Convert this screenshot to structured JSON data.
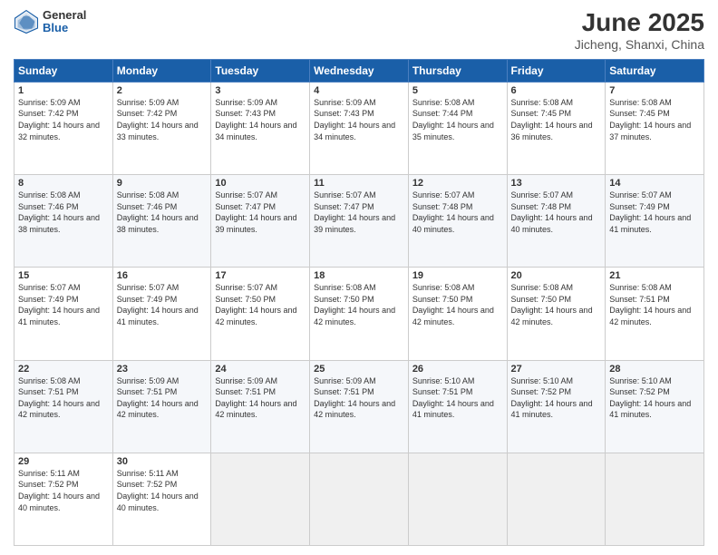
{
  "header": {
    "logo_general": "General",
    "logo_blue": "Blue",
    "title": "June 2025",
    "subtitle": "Jicheng, Shanxi, China"
  },
  "weekdays": [
    "Sunday",
    "Monday",
    "Tuesday",
    "Wednesday",
    "Thursday",
    "Friday",
    "Saturday"
  ],
  "weeks": [
    [
      {
        "day": "1",
        "sunrise": "5:09 AM",
        "sunset": "7:42 PM",
        "daylight": "14 hours and 32 minutes."
      },
      {
        "day": "2",
        "sunrise": "5:09 AM",
        "sunset": "7:42 PM",
        "daylight": "14 hours and 33 minutes."
      },
      {
        "day": "3",
        "sunrise": "5:09 AM",
        "sunset": "7:43 PM",
        "daylight": "14 hours and 34 minutes."
      },
      {
        "day": "4",
        "sunrise": "5:09 AM",
        "sunset": "7:43 PM",
        "daylight": "14 hours and 34 minutes."
      },
      {
        "day": "5",
        "sunrise": "5:08 AM",
        "sunset": "7:44 PM",
        "daylight": "14 hours and 35 minutes."
      },
      {
        "day": "6",
        "sunrise": "5:08 AM",
        "sunset": "7:45 PM",
        "daylight": "14 hours and 36 minutes."
      },
      {
        "day": "7",
        "sunrise": "5:08 AM",
        "sunset": "7:45 PM",
        "daylight": "14 hours and 37 minutes."
      }
    ],
    [
      {
        "day": "8",
        "sunrise": "5:08 AM",
        "sunset": "7:46 PM",
        "daylight": "14 hours and 38 minutes."
      },
      {
        "day": "9",
        "sunrise": "5:08 AM",
        "sunset": "7:46 PM",
        "daylight": "14 hours and 38 minutes."
      },
      {
        "day": "10",
        "sunrise": "5:07 AM",
        "sunset": "7:47 PM",
        "daylight": "14 hours and 39 minutes."
      },
      {
        "day": "11",
        "sunrise": "5:07 AM",
        "sunset": "7:47 PM",
        "daylight": "14 hours and 39 minutes."
      },
      {
        "day": "12",
        "sunrise": "5:07 AM",
        "sunset": "7:48 PM",
        "daylight": "14 hours and 40 minutes."
      },
      {
        "day": "13",
        "sunrise": "5:07 AM",
        "sunset": "7:48 PM",
        "daylight": "14 hours and 40 minutes."
      },
      {
        "day": "14",
        "sunrise": "5:07 AM",
        "sunset": "7:49 PM",
        "daylight": "14 hours and 41 minutes."
      }
    ],
    [
      {
        "day": "15",
        "sunrise": "5:07 AM",
        "sunset": "7:49 PM",
        "daylight": "14 hours and 41 minutes."
      },
      {
        "day": "16",
        "sunrise": "5:07 AM",
        "sunset": "7:49 PM",
        "daylight": "14 hours and 41 minutes."
      },
      {
        "day": "17",
        "sunrise": "5:07 AM",
        "sunset": "7:50 PM",
        "daylight": "14 hours and 42 minutes."
      },
      {
        "day": "18",
        "sunrise": "5:08 AM",
        "sunset": "7:50 PM",
        "daylight": "14 hours and 42 minutes."
      },
      {
        "day": "19",
        "sunrise": "5:08 AM",
        "sunset": "7:50 PM",
        "daylight": "14 hours and 42 minutes."
      },
      {
        "day": "20",
        "sunrise": "5:08 AM",
        "sunset": "7:50 PM",
        "daylight": "14 hours and 42 minutes."
      },
      {
        "day": "21",
        "sunrise": "5:08 AM",
        "sunset": "7:51 PM",
        "daylight": "14 hours and 42 minutes."
      }
    ],
    [
      {
        "day": "22",
        "sunrise": "5:08 AM",
        "sunset": "7:51 PM",
        "daylight": "14 hours and 42 minutes."
      },
      {
        "day": "23",
        "sunrise": "5:09 AM",
        "sunset": "7:51 PM",
        "daylight": "14 hours and 42 minutes."
      },
      {
        "day": "24",
        "sunrise": "5:09 AM",
        "sunset": "7:51 PM",
        "daylight": "14 hours and 42 minutes."
      },
      {
        "day": "25",
        "sunrise": "5:09 AM",
        "sunset": "7:51 PM",
        "daylight": "14 hours and 42 minutes."
      },
      {
        "day": "26",
        "sunrise": "5:10 AM",
        "sunset": "7:51 PM",
        "daylight": "14 hours and 41 minutes."
      },
      {
        "day": "27",
        "sunrise": "5:10 AM",
        "sunset": "7:52 PM",
        "daylight": "14 hours and 41 minutes."
      },
      {
        "day": "28",
        "sunrise": "5:10 AM",
        "sunset": "7:52 PM",
        "daylight": "14 hours and 41 minutes."
      }
    ],
    [
      {
        "day": "29",
        "sunrise": "5:11 AM",
        "sunset": "7:52 PM",
        "daylight": "14 hours and 40 minutes."
      },
      {
        "day": "30",
        "sunrise": "5:11 AM",
        "sunset": "7:52 PM",
        "daylight": "14 hours and 40 minutes."
      },
      null,
      null,
      null,
      null,
      null
    ]
  ]
}
